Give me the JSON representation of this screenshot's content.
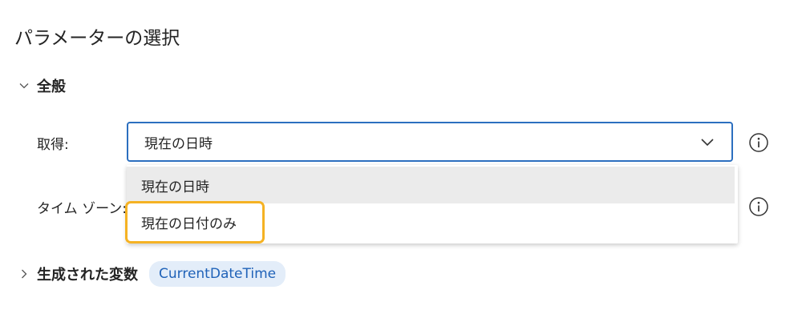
{
  "title": "パラメーターの選択",
  "general_section": {
    "label": "全般",
    "expanded": true,
    "icon": "chevron-down-icon"
  },
  "fields": {
    "get_label": "取得:",
    "get_value": "現在の日時",
    "timezone_label": "タイム ゾーン:"
  },
  "dropdown": {
    "options": [
      "現在の日時",
      "現在の日付のみ"
    ],
    "hovered_index": 0,
    "highlighted_index": 1
  },
  "variables_section": {
    "label": "生成された変数",
    "expanded": false,
    "icon": "chevron-right-icon",
    "variable": "CurrentDateTime"
  },
  "colors": {
    "accent": "#2c6fbf",
    "highlight_border": "#f5b223",
    "chip_bg": "#e3edf9",
    "chip_text": "#1f62b8",
    "hover_bg": "#ebebeb"
  }
}
